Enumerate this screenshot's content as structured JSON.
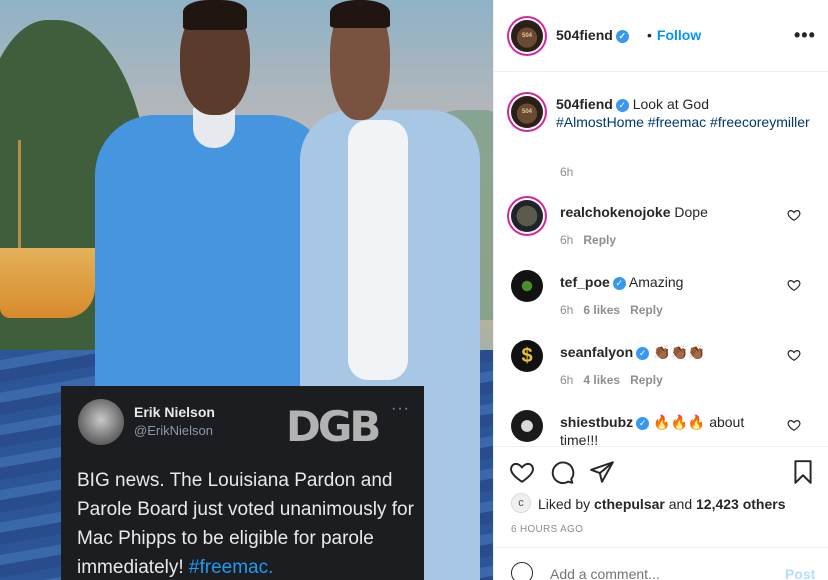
{
  "media": {
    "tweet": {
      "name": "Erik Nielson",
      "handle": "@ErikNielson",
      "logo": "DGB",
      "more": "···",
      "text": "BIG news.  The Louisiana Pardon and Parole Board just voted unanimously for Mac Phipps to be eligible for parole immediately! ",
      "hashtag": "#freemac."
    }
  },
  "header": {
    "username": "504fiend",
    "follow": "Follow",
    "separator": "•",
    "more": "•••"
  },
  "caption": {
    "username": "504fiend",
    "text": "Look at God",
    "hashtags": "#AlmostHome #freemac #freecoreymiller",
    "time": "6h"
  },
  "comments": [
    {
      "username": "realchokenojoke",
      "text": "Dope",
      "time": "6h",
      "likes": "",
      "reply": "Reply",
      "verified": false
    },
    {
      "username": "tef_poe",
      "text": "Amazing",
      "time": "6h",
      "likes": "6 likes",
      "reply": "Reply",
      "verified": true
    },
    {
      "username": "seanfalyon",
      "text": "👏🏾👏🏾👏🏾",
      "time": "6h",
      "likes": "4 likes",
      "reply": "Reply",
      "verified": true
    },
    {
      "username": "shiestbubz",
      "text": "🔥🔥🔥 about time!!!",
      "time": "",
      "likes": "",
      "reply": "",
      "verified": true
    }
  ],
  "actions": {
    "liked_by_prefix": "Liked by ",
    "liked_by_user": "cthepulsar",
    "liked_by_and": " and ",
    "liked_by_count": "12,423 others",
    "time_ago": "6 HOURS AGO"
  },
  "add_comment": {
    "placeholder": "Add a comment...",
    "post": "Post"
  },
  "colors": {
    "accent": "#0095f6",
    "verified": "#3897f0",
    "ring": "#d6249f"
  }
}
